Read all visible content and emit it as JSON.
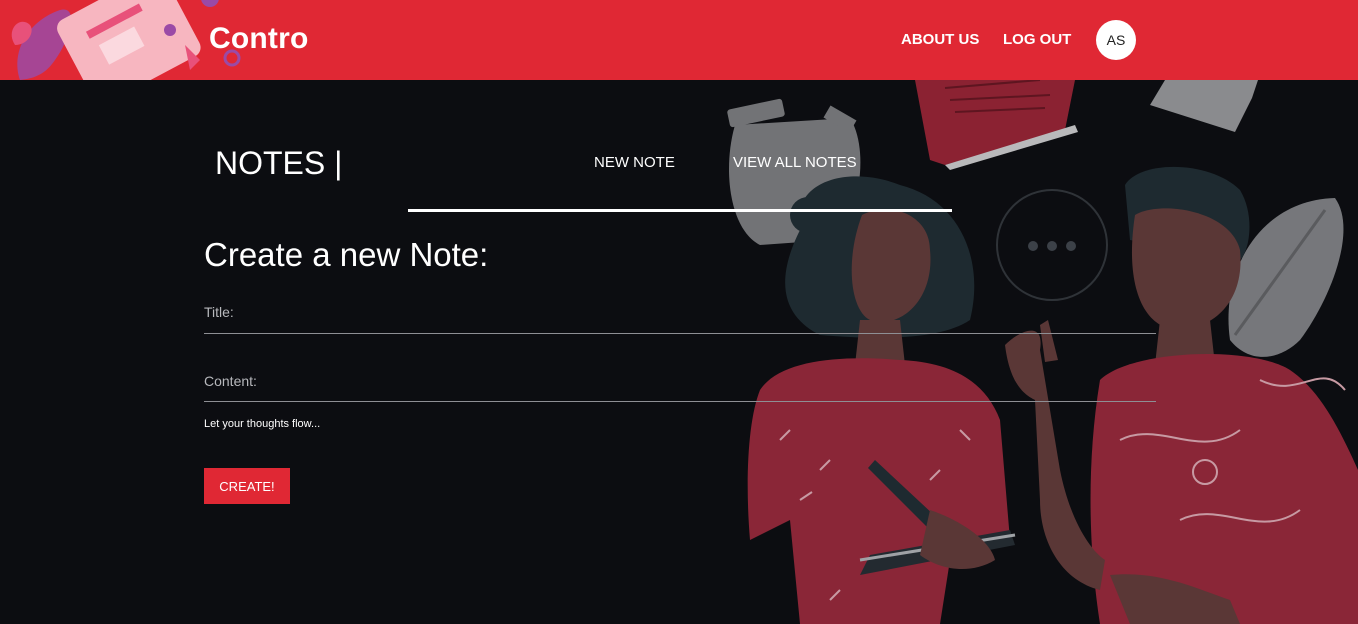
{
  "header": {
    "brand": "Contro",
    "nav": {
      "about": "ABOUT US",
      "logout": "LOG OUT"
    },
    "avatar_initials": "AS"
  },
  "notes": {
    "heading": "NOTES |",
    "tabs": {
      "new_note": "NEW NOTE",
      "view_all": "VIEW ALL NOTES"
    }
  },
  "form": {
    "title": "Create a new Note:",
    "title_label": "Title:",
    "content_label": "Content:",
    "hint": "Let your thoughts flow...",
    "submit_label": "CREATE!"
  },
  "colors": {
    "accent": "#e02834",
    "background": "#0c0d11"
  }
}
